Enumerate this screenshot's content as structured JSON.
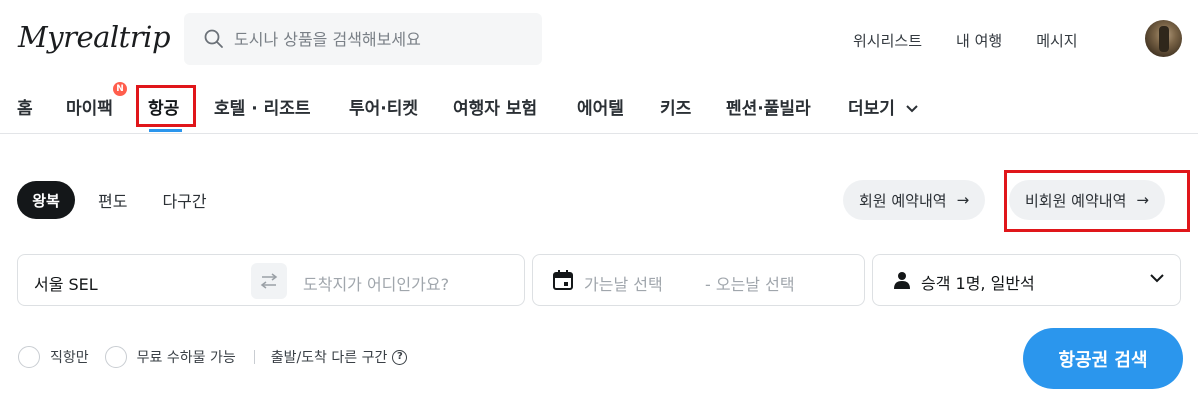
{
  "header": {
    "logo": "Myrealtrip",
    "search_placeholder": "도시나 상품을 검색해보세요",
    "links": [
      "위시리스트",
      "내 여행",
      "메시지"
    ]
  },
  "nav": {
    "items": [
      "홈",
      "마이팩",
      "항공",
      "호텔 · 리조트",
      "투어·티켓",
      "여행자 보험",
      "에어텔",
      "키즈",
      "펜션·풀빌라",
      "더보기"
    ],
    "active": "항공",
    "badge": "N"
  },
  "trip_types": {
    "active": "왕복",
    "options": [
      "편도",
      "다구간"
    ]
  },
  "reservation": {
    "member": "회원 예약내역",
    "nonmember": "비회원 예약내역",
    "arrow": "→"
  },
  "search_form": {
    "origin": "서울 SEL",
    "destination_placeholder": "도착지가 어디인가요?",
    "depart_placeholder": "가는날 선택",
    "return_placeholder": "- 오는날 선택",
    "passengers": "승객 1명, 일반석"
  },
  "options": {
    "direct": "직항만",
    "free_baggage": "무료 수하물 가능",
    "open_jaw": "출발/도착 다른 구간",
    "help": "?"
  },
  "search_button": "항공권 검색",
  "colors": {
    "accent": "#2b96ed",
    "highlight_box": "#e0161a",
    "badge": "#ff5e4d"
  }
}
